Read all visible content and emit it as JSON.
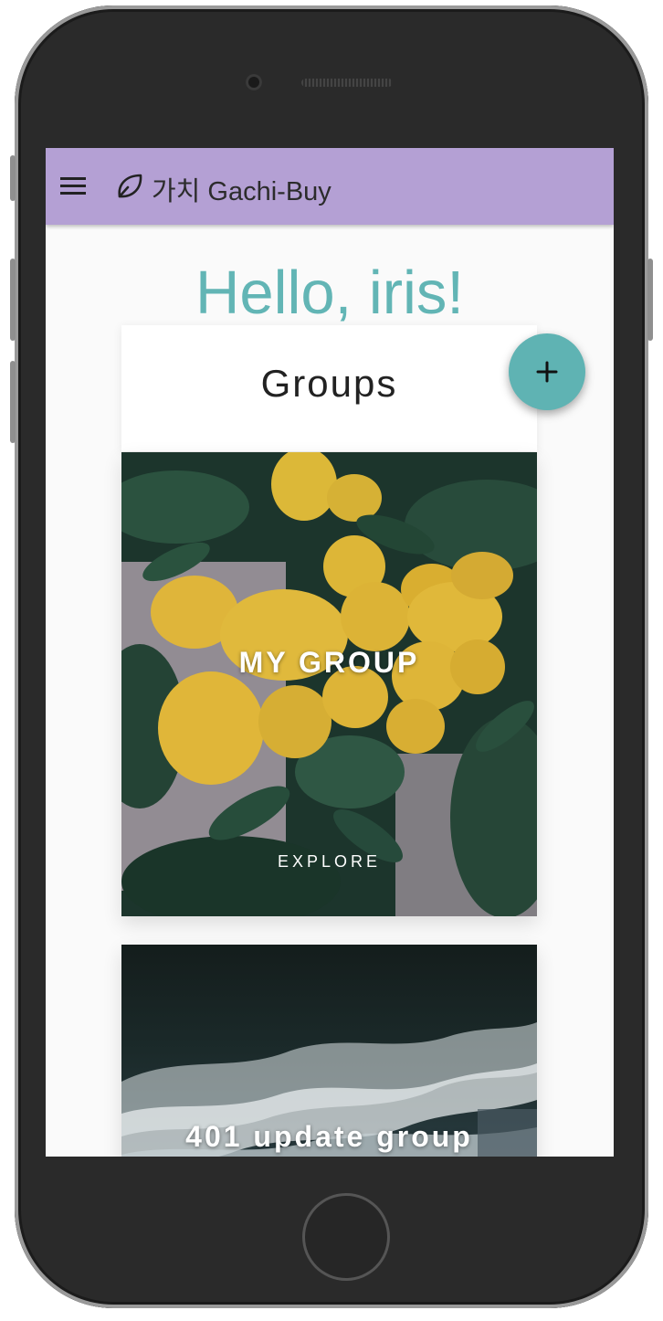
{
  "app": {
    "title": "가치 Gachi-Buy",
    "logo_icon": "leaf-icon",
    "menu_icon": "menu-icon",
    "appbar_color": "#b4a0d4"
  },
  "page": {
    "greeting": "Hello, iris!",
    "greeting_color": "#62b5b5"
  },
  "groups_section": {
    "title": "Groups",
    "add_button": {
      "icon": "plus-icon",
      "color": "#5fb3b3"
    },
    "cards": [
      {
        "title": "MY GROUP",
        "action": "EXPLORE",
        "image": "lemon-tree-photo"
      },
      {
        "title": "401 update group",
        "image": "ocean-waves-photo"
      }
    ]
  }
}
